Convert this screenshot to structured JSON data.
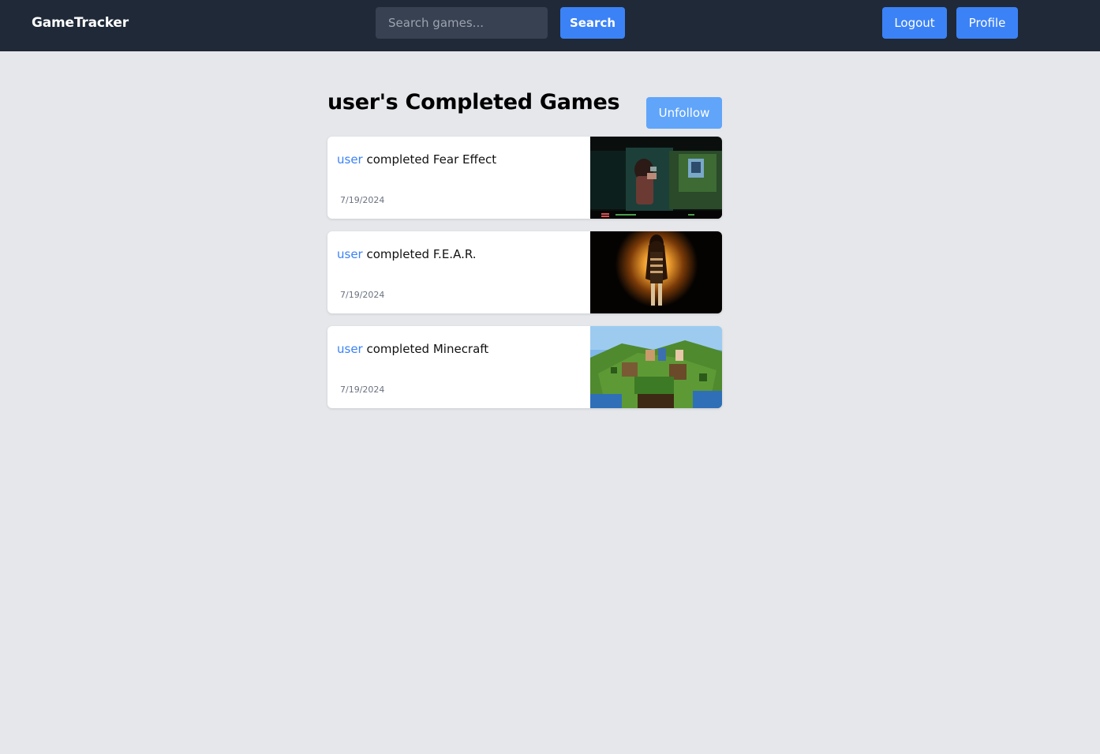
{
  "header": {
    "brand": "GameTracker",
    "search_placeholder": "Search games...",
    "search_value": "",
    "search_button": "Search",
    "logout_button": "Logout",
    "profile_button": "Profile"
  },
  "main": {
    "title": "user's Completed Games",
    "unfollow_button": "Unfollow",
    "entries": [
      {
        "user": "user",
        "action": " completed ",
        "game": "Fear Effect",
        "date": "7/19/2024"
      },
      {
        "user": "user",
        "action": " completed ",
        "game": "F.E.A.R.",
        "date": "7/19/2024"
      },
      {
        "user": "user",
        "action": " completed ",
        "game": "Minecraft",
        "date": "7/19/2024"
      }
    ]
  },
  "colors": {
    "navbar": "#1f2937",
    "background": "#e5e7eb",
    "accent": "#3b82f6",
    "unfollow": "#60a5fa",
    "user_link": "#3b82f6"
  }
}
